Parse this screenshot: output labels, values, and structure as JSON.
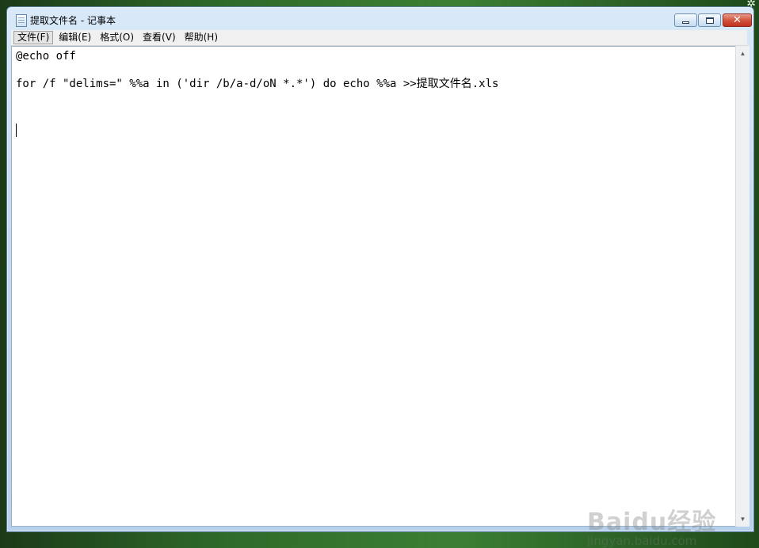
{
  "window": {
    "title": "提取文件名 - 记事本",
    "controls": {
      "close_glyph": "✕"
    }
  },
  "menubar": {
    "items": [
      {
        "label": "文件(F)"
      },
      {
        "label": "编辑(E)"
      },
      {
        "label": "格式(O)"
      },
      {
        "label": "查看(V)"
      },
      {
        "label": "帮助(H)"
      }
    ]
  },
  "editor": {
    "lines": [
      "@echo off",
      "for /f \"delims=\" %%a in ('dir /b/a-d/oN *.*') do echo %%a >>提取文件名.xls"
    ]
  },
  "scrollbar": {
    "up_glyph": "▲",
    "down_glyph": "▼"
  },
  "watermark": {
    "logo": "Baidu经验",
    "url": "jingyan.baidu.com"
  },
  "icons": {
    "app": "notepad-icon",
    "minimize": "minimize-icon",
    "maximize": "maximize-icon",
    "close": "close-icon"
  }
}
